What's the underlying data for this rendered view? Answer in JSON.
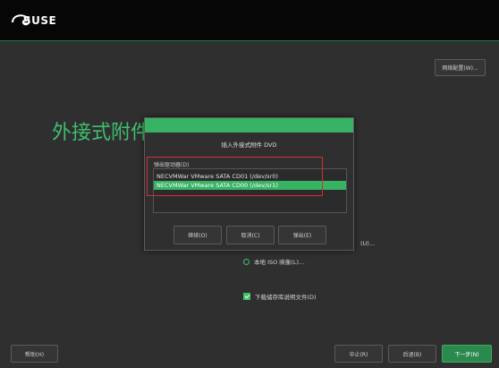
{
  "header": {
    "brand": "SUSE"
  },
  "top_right": {
    "network_config_label": "网络配置(W)..."
  },
  "page": {
    "title": "外接式附件"
  },
  "options": {
    "partial_label": "(U)...",
    "local_iso_label": "本地 ISO 映像(L)...",
    "download_label": "下载储存库说明文件(D)"
  },
  "dialog": {
    "title": "插入外接式附件 DVD",
    "drive_label": "弹出驱动器(D)",
    "drives": [
      {
        "label": "NECVMWar VMware SATA CD01 (/dev/sr0)",
        "selected": false
      },
      {
        "label": "NECVMWar VMware SATA CD00 (/dev/sr1)",
        "selected": true
      }
    ],
    "buttons": {
      "continue": "继续(O)",
      "cancel": "取消(C)",
      "eject": "弹出(E)"
    }
  },
  "footer": {
    "help": "帮助(H)",
    "abort": "中止(R)",
    "back": "后退(B)",
    "next": "下一步(N)"
  },
  "colors": {
    "accent": "#37b363",
    "title": "#3fbf6e",
    "highlight": "#d03030"
  }
}
